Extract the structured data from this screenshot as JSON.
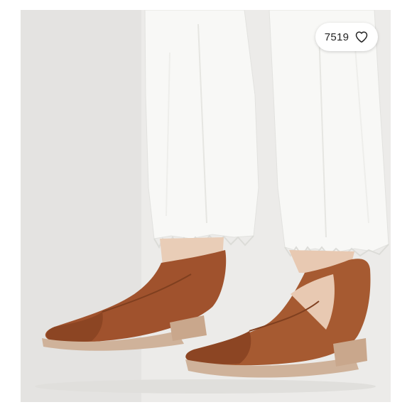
{
  "listing": {
    "image": {
      "subject": "",
      "background_color": "#ececea",
      "jeans_color": "#f7f7f5",
      "shoe_color": "#a0522d",
      "heel_color": "#c9a78c"
    },
    "likes": {
      "count": "7519",
      "icon": "heart-outline-icon"
    }
  }
}
